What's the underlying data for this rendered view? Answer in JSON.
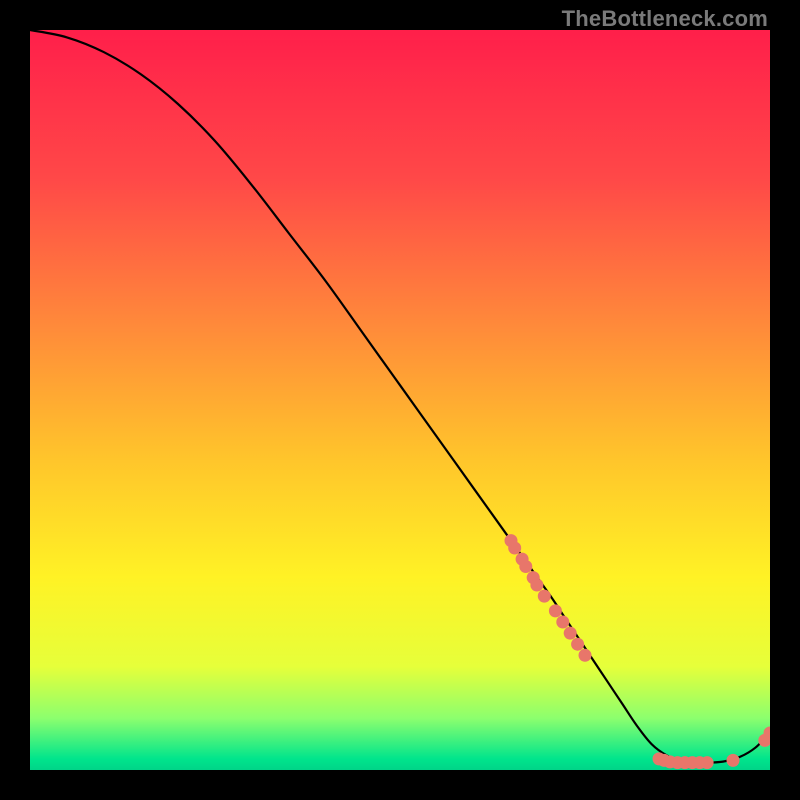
{
  "watermark": "TheBottleneck.com",
  "chart_data": {
    "type": "line",
    "title": "",
    "xlabel": "",
    "ylabel": "",
    "xlim": [
      0,
      100
    ],
    "ylim": [
      0,
      100
    ],
    "curve": {
      "name": "bottleneck-curve",
      "x": [
        0,
        5,
        10,
        15,
        20,
        25,
        30,
        35,
        40,
        45,
        50,
        55,
        60,
        65,
        70,
        72,
        74,
        76,
        78,
        80,
        82,
        84,
        86,
        88,
        90,
        92,
        94,
        96,
        98,
        100
      ],
      "y": [
        100,
        99,
        97,
        94,
        90,
        85,
        79,
        72.5,
        66,
        59,
        52,
        45,
        38,
        31,
        24,
        21,
        18,
        15,
        12,
        9,
        6,
        3.5,
        2,
        1.2,
        1,
        1,
        1.2,
        1.8,
        3,
        5
      ]
    },
    "markers": {
      "name": "highlight-points",
      "color": "#e8766a",
      "points": [
        {
          "x": 65.0,
          "y": 31.0
        },
        {
          "x": 65.5,
          "y": 30.0
        },
        {
          "x": 66.5,
          "y": 28.5
        },
        {
          "x": 67.0,
          "y": 27.5
        },
        {
          "x": 68.0,
          "y": 26.0
        },
        {
          "x": 68.5,
          "y": 25.0
        },
        {
          "x": 69.5,
          "y": 23.5
        },
        {
          "x": 71.0,
          "y": 21.5
        },
        {
          "x": 72.0,
          "y": 20.0
        },
        {
          "x": 73.0,
          "y": 18.5
        },
        {
          "x": 74.0,
          "y": 17.0
        },
        {
          "x": 75.0,
          "y": 15.5
        },
        {
          "x": 85.0,
          "y": 1.5
        },
        {
          "x": 85.7,
          "y": 1.3
        },
        {
          "x": 86.5,
          "y": 1.1
        },
        {
          "x": 87.5,
          "y": 1.0
        },
        {
          "x": 88.5,
          "y": 1.0
        },
        {
          "x": 89.5,
          "y": 1.0
        },
        {
          "x": 90.5,
          "y": 1.0
        },
        {
          "x": 91.5,
          "y": 1.0
        },
        {
          "x": 95.0,
          "y": 1.3
        },
        {
          "x": 99.3,
          "y": 4.0
        },
        {
          "x": 100.0,
          "y": 5.0
        }
      ]
    },
    "background_gradient": {
      "stops": [
        {
          "pos": 0.0,
          "color": "#ff1f4a"
        },
        {
          "pos": 0.2,
          "color": "#ff4848"
        },
        {
          "pos": 0.4,
          "color": "#ff8a3a"
        },
        {
          "pos": 0.58,
          "color": "#ffc52b"
        },
        {
          "pos": 0.74,
          "color": "#fff225"
        },
        {
          "pos": 0.86,
          "color": "#e6ff3a"
        },
        {
          "pos": 0.93,
          "color": "#8cff6e"
        },
        {
          "pos": 0.985,
          "color": "#00e58c"
        },
        {
          "pos": 1.0,
          "color": "#00d488"
        }
      ]
    }
  }
}
